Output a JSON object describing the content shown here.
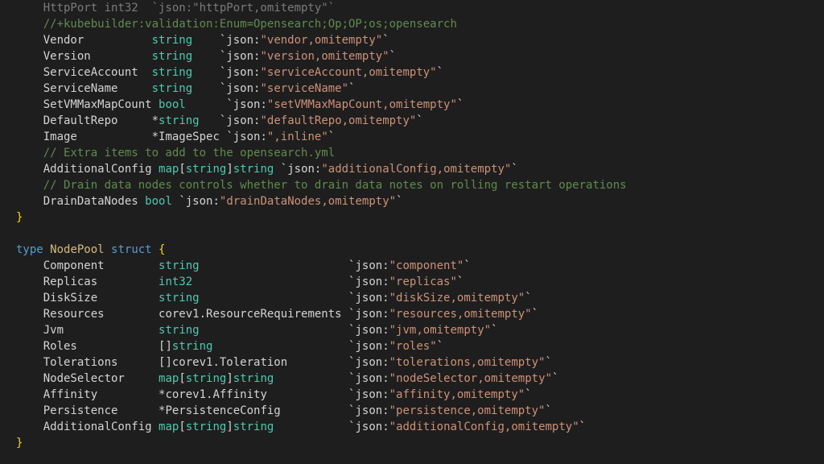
{
  "code": {
    "top_dim": "    HttpPort int32  `json:\"httpPort,omitempty\"`",
    "kb_comment": "    //+kubebuilder:validation:Enum=Opensearch;Op;OP;os;opensearch",
    "block1": [
      {
        "field": "Vendor",
        "pad1": "          ",
        "type_parts": [
          {
            "t": "string",
            "c": "c-type"
          }
        ],
        "pad2": "    ",
        "tag": "`json:\"vendor,omitempty\"`"
      },
      {
        "field": "Version",
        "pad1": "         ",
        "type_parts": [
          {
            "t": "string",
            "c": "c-type"
          }
        ],
        "pad2": "    ",
        "tag": "`json:\"version,omitempty\"`"
      },
      {
        "field": "ServiceAccount",
        "pad1": "  ",
        "type_parts": [
          {
            "t": "string",
            "c": "c-type"
          }
        ],
        "pad2": "    ",
        "tag": "`json:\"serviceAccount,omitempty\"`"
      },
      {
        "field": "ServiceName",
        "pad1": "     ",
        "type_parts": [
          {
            "t": "string",
            "c": "c-type"
          }
        ],
        "pad2": "    ",
        "tag": "`json:\"serviceName\"`"
      },
      {
        "field": "SetVMMaxMapCount",
        "pad1": " ",
        "type_parts": [
          {
            "t": "bool",
            "c": "c-type"
          }
        ],
        "pad2": "      ",
        "tag": "`json:\"setVMMaxMapCount,omitempty\"`"
      },
      {
        "field": "DefaultRepo",
        "pad1": "     ",
        "type_parts": [
          {
            "t": "*",
            "c": "c-star"
          },
          {
            "t": "string",
            "c": "c-type"
          }
        ],
        "pad2": "   ",
        "tag": "`json:\"defaultRepo,omitempty\"`"
      },
      {
        "field": "Image",
        "pad1": "           ",
        "type_parts": [
          {
            "t": "*ImageSpec",
            "c": "c-field"
          }
        ],
        "pad2": " ",
        "tag": "`json:\",inline\"`"
      }
    ],
    "mid_comment1": "    // Extra items to add to the opensearch.yml",
    "addlcfg1": {
      "field": "AdditionalConfig",
      "pad1": " ",
      "type_parts": [
        {
          "t": "map",
          "c": "c-type"
        },
        {
          "t": "[",
          "c": "c-punct"
        },
        {
          "t": "string",
          "c": "c-type"
        },
        {
          "t": "]",
          "c": "c-punct"
        },
        {
          "t": "string",
          "c": "c-type"
        }
      ],
      "pad2": " ",
      "tag": "`json:\"additionalConfig,omitempty\"`"
    },
    "mid_comment2": "    // Drain data nodes controls whether to drain data notes on rolling restart operations",
    "drain": {
      "field": "DrainDataNodes",
      "pad1": " ",
      "type_parts": [
        {
          "t": "bool",
          "c": "c-type"
        }
      ],
      "pad2": " ",
      "tag": "`json:\"drainDataNodes,omitempty\"`"
    },
    "nodepool_decl": {
      "kw_type": "type",
      "name": "NodePool",
      "kw_struct": "struct",
      "brace": "{"
    },
    "block2": [
      {
        "field": "Component",
        "pad1": "        ",
        "type_parts": [
          {
            "t": "string",
            "c": "c-type"
          }
        ],
        "pad2": "                      ",
        "tag": "`json:\"component\"`"
      },
      {
        "field": "Replicas",
        "pad1": "         ",
        "type_parts": [
          {
            "t": "int32",
            "c": "c-type"
          }
        ],
        "pad2": "                       ",
        "tag": "`json:\"replicas\"`"
      },
      {
        "field": "DiskSize",
        "pad1": "         ",
        "type_parts": [
          {
            "t": "string",
            "c": "c-type"
          }
        ],
        "pad2": "                      ",
        "tag": "`json:\"diskSize,omitempty\"`"
      },
      {
        "field": "Resources",
        "pad1": "        ",
        "type_parts": [
          {
            "t": "corev1.ResourceRequirements",
            "c": "c-field"
          }
        ],
        "pad2": " ",
        "tag": "`json:\"resources,omitempty\"`"
      },
      {
        "field": "Jvm",
        "pad1": "              ",
        "type_parts": [
          {
            "t": "string",
            "c": "c-type"
          }
        ],
        "pad2": "                      ",
        "tag": "`json:\"jvm,omitempty\"`"
      },
      {
        "field": "Roles",
        "pad1": "            ",
        "type_parts": [
          {
            "t": "[]",
            "c": "c-punct"
          },
          {
            "t": "string",
            "c": "c-type"
          }
        ],
        "pad2": "                    ",
        "tag": "`json:\"roles\"`"
      },
      {
        "field": "Tolerations",
        "pad1": "      ",
        "type_parts": [
          {
            "t": "[]",
            "c": "c-punct"
          },
          {
            "t": "corev1.Toleration",
            "c": "c-field"
          }
        ],
        "pad2": "         ",
        "tag": "`json:\"tolerations,omitempty\"`"
      },
      {
        "field": "NodeSelector",
        "pad1": "     ",
        "type_parts": [
          {
            "t": "map",
            "c": "c-type"
          },
          {
            "t": "[",
            "c": "c-punct"
          },
          {
            "t": "string",
            "c": "c-type"
          },
          {
            "t": "]",
            "c": "c-punct"
          },
          {
            "t": "string",
            "c": "c-type"
          }
        ],
        "pad2": "           ",
        "tag": "`json:\"nodeSelector,omitempty\"`"
      },
      {
        "field": "Affinity",
        "pad1": "         ",
        "type_parts": [
          {
            "t": "*corev1.Affinity",
            "c": "c-field"
          }
        ],
        "pad2": "            ",
        "tag": "`json:\"affinity,omitempty\"`"
      },
      {
        "field": "Persistence",
        "pad1": "      ",
        "type_parts": [
          {
            "t": "*PersistenceConfig",
            "c": "c-field"
          }
        ],
        "pad2": "          ",
        "tag": "`json:\"persistence,omitempty\"`"
      },
      {
        "field": "AdditionalConfig",
        "pad1": " ",
        "type_parts": [
          {
            "t": "map",
            "c": "c-type"
          },
          {
            "t": "[",
            "c": "c-punct"
          },
          {
            "t": "string",
            "c": "c-type"
          },
          {
            "t": "]",
            "c": "c-punct"
          },
          {
            "t": "string",
            "c": "c-type"
          }
        ],
        "pad2": "           ",
        "tag": "`json:\"additionalConfig,omitempty\"`"
      }
    ],
    "close_brace": "}"
  }
}
